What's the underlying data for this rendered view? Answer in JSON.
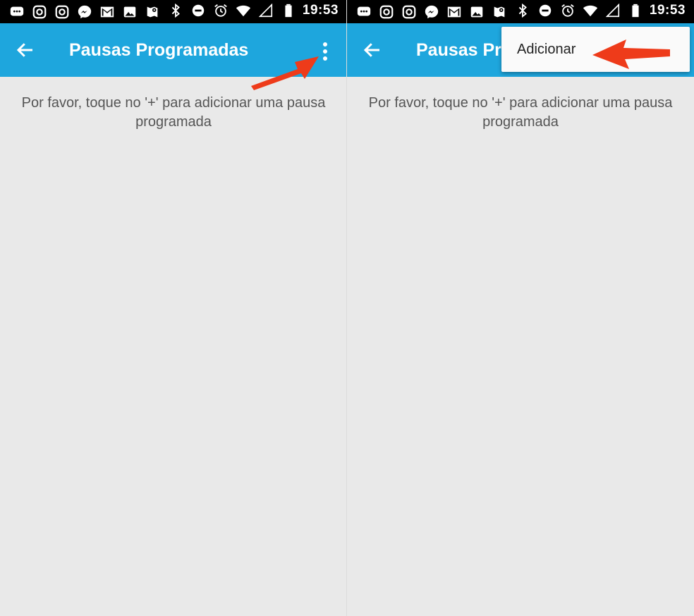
{
  "status_bar": {
    "time": "19:53",
    "icons": [
      "chat-bubble-icon",
      "instagram-icon",
      "instagram-icon",
      "messenger-icon",
      "gmail-icon",
      "photos-icon",
      "maps-icon",
      "bluetooth-icon",
      "do-not-disturb-icon",
      "alarm-icon",
      "wifi-icon",
      "signal-icon",
      "battery-icon"
    ]
  },
  "toolbar": {
    "title": "Pausas Programadas"
  },
  "content": {
    "empty_message_line1": "Por favor, toque no '+' para adicionar uma pausa",
    "empty_message_line2": "programada"
  },
  "menu": {
    "items": [
      {
        "label": "Adicionar"
      }
    ]
  },
  "colors": {
    "toolbar": "#1ea6dd",
    "background": "#e9e9e9",
    "annotation_arrow": "#ee3b1a"
  }
}
